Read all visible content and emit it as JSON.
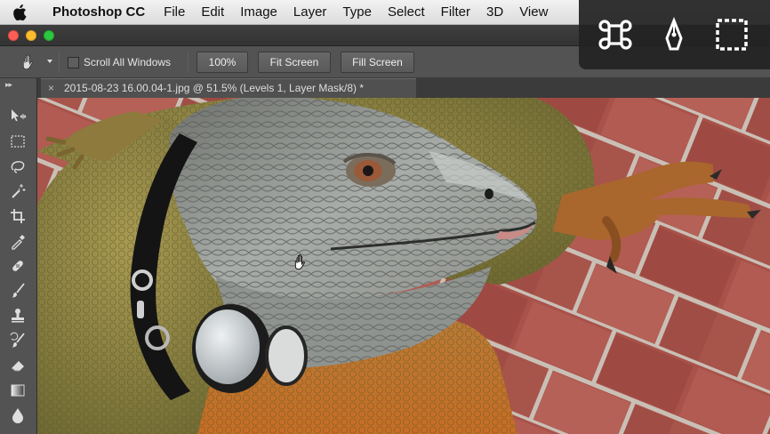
{
  "menubar": {
    "app_name": "Photoshop CC",
    "items": [
      "File",
      "Edit",
      "Image",
      "Layer",
      "Type",
      "Select",
      "Filter",
      "3D",
      "View"
    ]
  },
  "options": {
    "scroll_all_windows_label": "Scroll All Windows",
    "scroll_all_windows_checked": false,
    "zoom_100_label": "100%",
    "fit_screen_label": "Fit Screen",
    "fill_screen_label": "Fill Screen"
  },
  "document": {
    "tab_close_glyph": "×",
    "tab_title": "2015-08-23 16.00.04-1.jpg @ 51.5% (Levels 1, Layer Mask/8) *"
  },
  "tools": [
    "move-tool",
    "marquee-tool",
    "lasso-tool",
    "magic-wand-tool",
    "crop-tool",
    "eyedropper-tool",
    "healing-brush-tool",
    "brush-tool",
    "clone-stamp-tool",
    "history-brush-tool",
    "eraser-tool",
    "gradient-tool",
    "blur-tool"
  ],
  "keyboard_overlay": {
    "icons": [
      "command-key-icon",
      "pen-tool-icon",
      "marquee-selection-icon"
    ]
  },
  "colors": {
    "menubar": "#e6e6e6",
    "panel": "#535353",
    "workspace": "#282828",
    "brick": "#a85048",
    "iguana_green": "#8a8a3e",
    "iguana_gray": "#9fa3a0"
  }
}
